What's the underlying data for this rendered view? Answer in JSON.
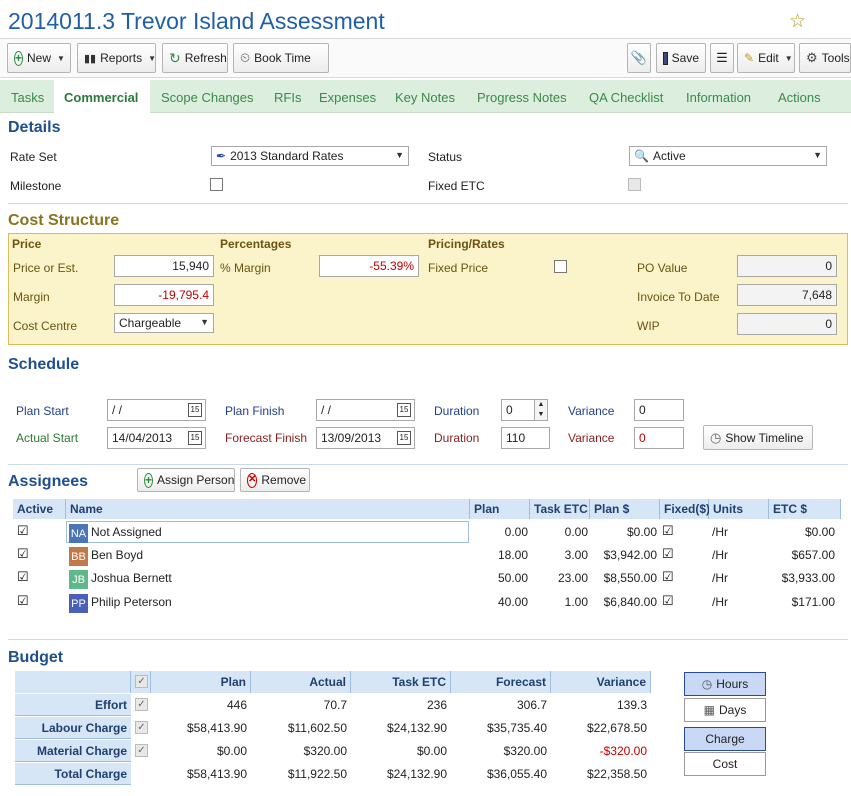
{
  "title": "2014011.3 Trevor Island Assessment",
  "toolbar": {
    "new": "New",
    "reports": "Reports",
    "refresh": "Refresh",
    "book_time": "Book Time",
    "save": "Save",
    "edit": "Edit",
    "tools": "Tools"
  },
  "tabs": [
    "Tasks",
    "Commercial",
    "Scope Changes",
    "RFIs",
    "Expenses",
    "Key Notes",
    "Progress Notes",
    "QA Checklist",
    "Information",
    "Actions"
  ],
  "details": {
    "heading": "Details",
    "rate_set_label": "Rate Set",
    "rate_set_value": "2013 Standard Rates",
    "status_label": "Status",
    "status_value": "Active",
    "milestone_label": "Milestone",
    "fixed_etc_label": "Fixed ETC"
  },
  "cost": {
    "heading": "Cost Structure",
    "price_heading": "Price",
    "percent_heading": "Percentages",
    "pricing_heading": "Pricing/Rates",
    "price_label": "Price or Est.",
    "price_value": "15,940",
    "margin_pct_label": "% Margin",
    "margin_pct_value": "-55.39%",
    "fixed_price_label": "Fixed Price",
    "po_label": "PO Value",
    "po_value": "0",
    "margin_label": "Margin",
    "margin_value": "-19,795.4",
    "invoice_label": "Invoice To Date",
    "invoice_value": "7,648",
    "cost_centre_label": "Cost Centre",
    "cost_centre_value": "Chargeable",
    "wip_label": "WIP",
    "wip_value": "0"
  },
  "schedule": {
    "heading": "Schedule",
    "plan_start_label": "Plan Start",
    "plan_start_value": " /  /",
    "plan_finish_label": "Plan Finish",
    "plan_finish_value": " /  /",
    "duration_label": "Duration",
    "duration_value": "0",
    "variance_label": "Variance",
    "variance_value": "0",
    "actual_start_label": "Actual Start",
    "actual_start_value": "14/04/2013",
    "forecast_finish_label": "Forecast Finish",
    "forecast_finish_value": "13/09/2013",
    "duration2_label": "Duration",
    "duration2_value": "110",
    "variance2_label": "Variance",
    "variance2_value": "0",
    "show_timeline": "Show Timeline"
  },
  "assignees": {
    "heading": "Assignees",
    "assign_button": "Assign Person",
    "remove_button": "Remove",
    "columns": [
      "Active",
      "Name",
      "Plan",
      "Task ETC",
      "Plan $",
      "Fixed($)",
      "Units",
      "ETC $"
    ],
    "rows": [
      {
        "initials": "NA",
        "color": "#4a76b8",
        "name": "Not Assigned",
        "plan": "0.00",
        "etc": "0.00",
        "plan_d": "$0.00",
        "units": "/Hr",
        "etc_d": "$0.00"
      },
      {
        "initials": "BB",
        "color": "#c07a4a",
        "name": "Ben Boyd",
        "plan": "18.00",
        "etc": "3.00",
        "plan_d": "$3,942.00",
        "units": "/Hr",
        "etc_d": "$657.00"
      },
      {
        "initials": "JB",
        "color": "#5fb88a",
        "name": "Joshua Bernett",
        "plan": "50.00",
        "etc": "23.00",
        "plan_d": "$8,550.00",
        "units": "/Hr",
        "etc_d": "$3,933.00"
      },
      {
        "initials": "PP",
        "color": "#4a5fb8",
        "name": "Philip Peterson",
        "plan": "40.00",
        "etc": "1.00",
        "plan_d": "$6,840.00",
        "units": "/Hr",
        "etc_d": "$171.00"
      }
    ]
  },
  "budget": {
    "heading": "Budget",
    "columns": [
      "Plan",
      "Actual",
      "Task ETC",
      "Forecast",
      "Variance"
    ],
    "rows": [
      {
        "label": "Effort",
        "values": [
          "446",
          "70.7",
          "236",
          "306.7",
          "139.3"
        ]
      },
      {
        "label": "Labour Charge",
        "values": [
          "$58,413.90",
          "$11,602.50",
          "$24,132.90",
          "$35,735.40",
          "$22,678.50"
        ]
      },
      {
        "label": "Material Charge",
        "values": [
          "$0.00",
          "$320.00",
          "$0.00",
          "$320.00",
          "-$320.00"
        ]
      },
      {
        "label": "Total Charge",
        "values": [
          "$58,413.90",
          "$11,922.50",
          "$24,132.90",
          "$36,055.40",
          "$22,358.50"
        ]
      }
    ],
    "hours": "Hours",
    "days": "Days",
    "charge": "Charge",
    "cost": "Cost"
  }
}
